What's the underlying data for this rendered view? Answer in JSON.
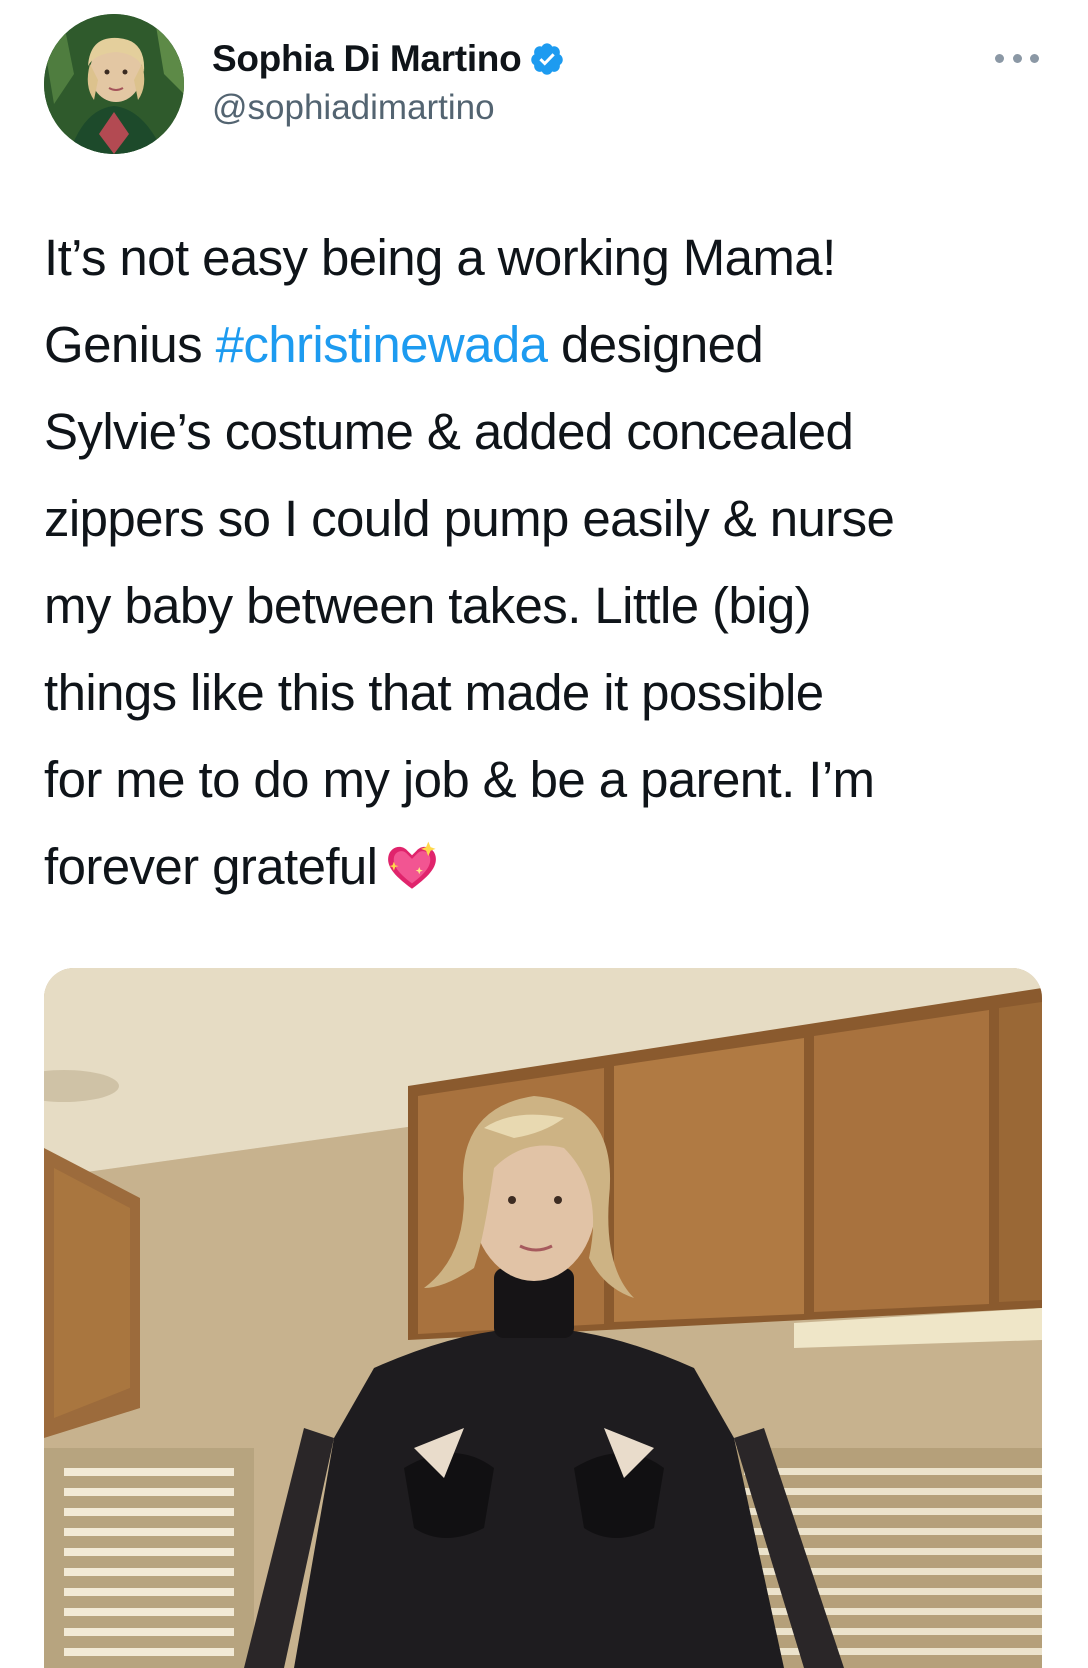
{
  "tweet": {
    "author": {
      "name": "Sophia Di Martino",
      "handle": "@sophiadimartino",
      "verified": true,
      "avatar_icon": "avatar-photo"
    },
    "more_icon": "more-horizontal-icon",
    "text_lines": [
      "It’s not easy being a working Mama!",
      "designed",
      "Sylvie’s costume & added concealed",
      "zippers so I could pump easily & nurse",
      "my baby between takes. Little (big)",
      "things like this that made it possible",
      "for me to do my job & be a parent. I’m",
      "forever grateful"
    ],
    "line2_prefix": "Genius",
    "hashtag": "#christinewada",
    "emoji_icon": "sparkling-heart-icon",
    "media": {
      "icon": "photo-woman-in-black-costume"
    }
  },
  "colors": {
    "text": "#0f1419",
    "secondary": "#536471",
    "link": "#1d9bf0",
    "verified": "#1d9bf0",
    "heart": "#e0246c"
  }
}
